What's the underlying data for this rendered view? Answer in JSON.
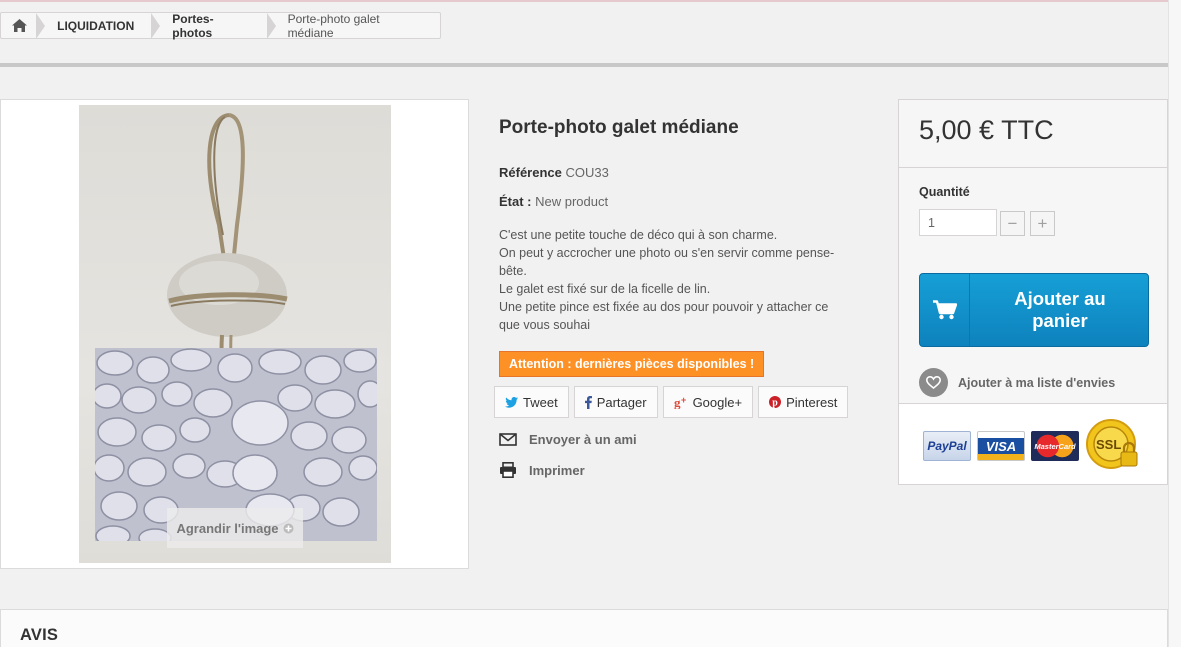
{
  "breadcrumb": {
    "home_icon": "home-icon",
    "items": [
      "LIQUIDATION",
      "Portes-photos",
      "Porte-photo galet médiane"
    ]
  },
  "product": {
    "image_overlay": "Agrandir l'image",
    "title": "Porte-photo galet médiane",
    "reference_label": "Référence",
    "reference_value": "COU33",
    "condition_label": "État :",
    "condition_value": "New product",
    "description": [
      "C'est une petite touche de déco qui à son charme.",
      "On peut y accrocher une photo ou s'en servir comme pense-",
      "bête.",
      "Le galet est fixé sur de la ficelle de lin.",
      "Une petite pince est fixée au dos pour pouvoir y attacher ce",
      "que vous souhai"
    ],
    "stock_warning": "Attention : dernières pièces disponibles !"
  },
  "social": {
    "tweet": "Tweet",
    "share": "Partager",
    "google": "Google+",
    "pinterest": "Pinterest"
  },
  "actions": {
    "send_friend": "Envoyer à un ami",
    "print": "Imprimer"
  },
  "buy_box": {
    "price": "5,00 € TTC",
    "quantity_label": "Quantité",
    "quantity_value": "1",
    "minus": "−",
    "plus": "+",
    "add_to_cart_line1": "Ajouter au",
    "add_to_cart_line2": "panier",
    "wishlist": "Ajouter à ma liste d'envies",
    "payment_logos": {
      "paypal": "PayPal",
      "visa": "VISA",
      "mastercard": "MasterCard",
      "ssl": "SSL"
    }
  },
  "reviews": {
    "title": "AVIS"
  },
  "colors": {
    "accent_blue": "#1596d0",
    "warning_orange": "#fe9126",
    "background": "#f2f1f1"
  }
}
